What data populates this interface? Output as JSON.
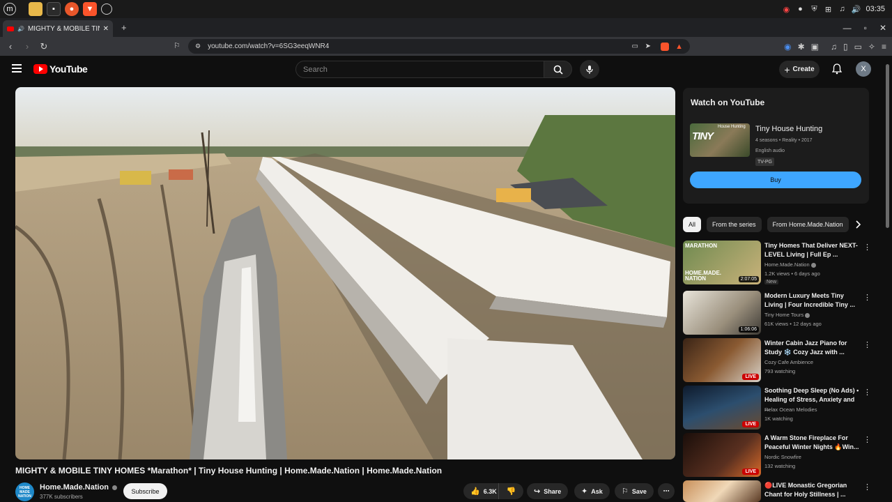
{
  "browser": {
    "tab_title": "MIGHTY & MOBILE TINY HOMES",
    "url": "youtube.com/watch?v=6SG3eeqWNR4",
    "clock": "03:35"
  },
  "header": {
    "logo_text": "YouTube",
    "search_placeholder": "Search",
    "create_label": "Create",
    "avatar_letter": "X"
  },
  "video": {
    "title": "MIGHTY & MOBILE TINY HOMES *Marathon* | Tiny House Hunting | Home.Made.Nation | Home.Made.Nation",
    "channel": "Home.Made.Nation",
    "channel_avatar_text": "HOME MADE NATION",
    "subscribers": "377K subscribers",
    "subscribe_label": "Subscribe",
    "likes": "6.3K",
    "share_label": "Share",
    "ask_label": "Ask",
    "save_label": "Save"
  },
  "watch_card": {
    "heading": "Watch on YouTube",
    "thumb_text": "TINY",
    "thumb_sub": "House Hunting",
    "show_title": "Tiny House Hunting",
    "meta": "4 seasons • Reality • 2017",
    "audio": "English audio",
    "rating": "TV-PG",
    "buy_label": "Buy"
  },
  "chips": [
    "All",
    "From the series",
    "From Home.Made.Nation"
  ],
  "recommendations": [
    {
      "title": "Tiny Homes That Deliver NEXT-LEVEL Living | Full Ep ...",
      "channel": "Home.Made.Nation",
      "stats": "1.2K views • 6 days ago",
      "duration": "2:07:05",
      "badge": "New",
      "thumb_color": "#7a8a5a"
    },
    {
      "title": "Modern Luxury Meets Tiny Living | Four Incredible Tiny ...",
      "channel": "Tiny Home Tours",
      "stats": "61K views • 12 days ago",
      "duration": "1:06:06",
      "thumb_color": "#c9c4b8"
    },
    {
      "title": "Winter Cabin Jazz Piano for Study ❄️ Cozy Jazz with ...",
      "channel": "Cozy Cafe Ambience",
      "stats": "793 watching",
      "live": "LIVE",
      "thumb_color": "#5a3a22"
    },
    {
      "title": "Soothing Deep Sleep (No Ads) • Healing of Stress, Anxiety and ...",
      "channel": "Relax Ocean Melodies",
      "stats": "1K watching",
      "live": "LIVE",
      "thumb_color": "#1d2f45"
    },
    {
      "title": "A Warm Stone Fireplace For Peaceful Winter Nights 🔥Win...",
      "channel": "Nordic Snowfire",
      "stats": "132 watching",
      "live": "LIVE",
      "thumb_color": "#2b1a14"
    },
    {
      "title": "🔴LIVE Monastic Gregorian Chant for Holy Stillness | ...",
      "channel": "",
      "stats": "",
      "thumb_color": "#d2a070"
    }
  ]
}
